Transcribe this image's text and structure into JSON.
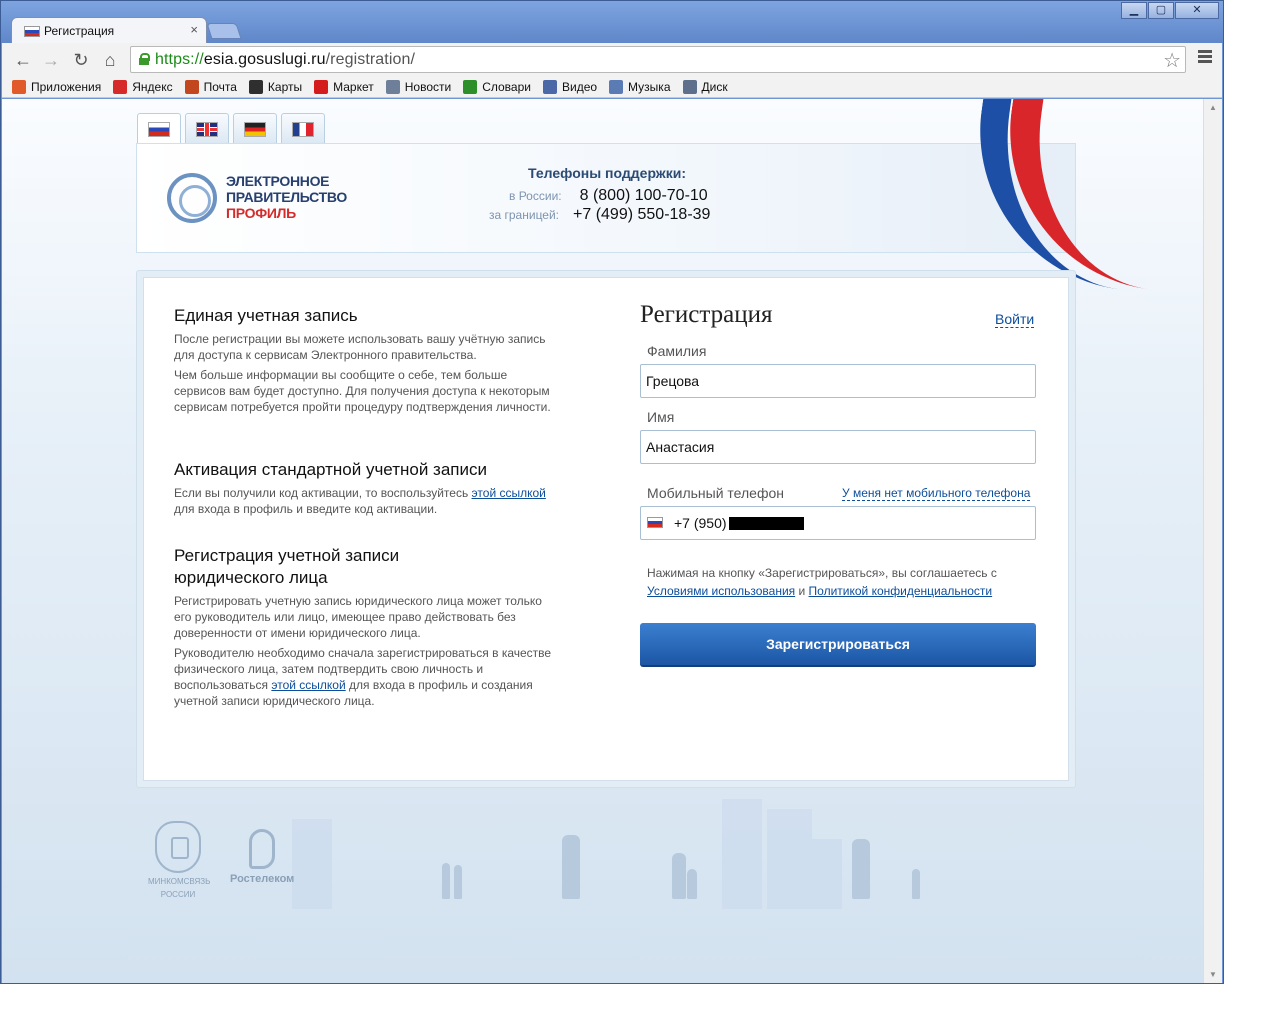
{
  "browser": {
    "tab_title": "Регистрация",
    "tab_close": "×",
    "window_buttons": [
      "▁",
      "▢",
      "✕"
    ],
    "url_scheme": "https://",
    "url_host": "esia.gosuslugi.ru",
    "url_path": "/registration/",
    "nav_icons": [
      "back-icon",
      "forward-icon",
      "reload-icon",
      "home-icon"
    ],
    "bookmarks": [
      {
        "label": "Приложения",
        "icon": "apps-icon",
        "color": "#e05a2a"
      },
      {
        "label": "Яндекс",
        "icon": "yandex-icon",
        "color": "#d62a2a"
      },
      {
        "label": "Почта",
        "icon": "mail-icon",
        "color": "#c2471f"
      },
      {
        "label": "Карты",
        "icon": "maps-icon",
        "color": "#2f2f2f"
      },
      {
        "label": "Маркет",
        "icon": "market-icon",
        "color": "#d41c1c"
      },
      {
        "label": "Новости",
        "icon": "news-icon",
        "color": "#6d7f99"
      },
      {
        "label": "Словари",
        "icon": "dict-icon",
        "color": "#2d8f2a"
      },
      {
        "label": "Видео",
        "icon": "video-icon",
        "color": "#4a69a6"
      },
      {
        "label": "Музыка",
        "icon": "music-icon",
        "color": "#5a7bb4"
      },
      {
        "label": "Диск",
        "icon": "disk-icon",
        "color": "#5d6f8b"
      }
    ]
  },
  "header": {
    "logo_line1": "ЭЛЕКТРОННОЕ",
    "logo_line2": "ПРАВИТЕЛЬСТВО",
    "logo_line3": "ПРОФИЛЬ",
    "support_title": "Телефоны поддержки:",
    "phone_russia_label": "в России:",
    "phone_russia": "8 (800) 100-70-10",
    "phone_abroad_label": "за границей:",
    "phone_abroad": "+7 (499) 550-18-39",
    "languages": [
      "ru",
      "en",
      "de",
      "fr"
    ]
  },
  "info": {
    "s1_title": "Единая учетная запись",
    "s1_p1": "После регистрации вы можете использовать вашу учётную запись для доступа к сервисам Электронного правительства.",
    "s1_p2": "Чем больше информации вы сообщите о себе, тем больше сервисов вам будет доступно. Для получения доступа к некоторым сервисам потребуется пройти процедуру подтверждения личности.",
    "s2_title": "Активация стандартной учетной записи",
    "s2_p_pre": "Если вы получили код активации, то воспользуйтесь ",
    "s2_link": "этой ссылкой",
    "s2_p_post": " для входа в профиль и введите код активации.",
    "s3_title_line1": "Регистрация учетной записи",
    "s3_title_line2": "юридического лица",
    "s3_p1": "Регистрировать учетную запись юридического лица может только его руководитель или лицо, имеющее право действовать без доверенности от имени юридического лица.",
    "s3_p2_pre": "Руководителю необходимо сначала зарегистрироваться в качестве физического лица, затем подтвердить свою личность и воспользоваться ",
    "s3_link": "этой ссылкой",
    "s3_p2_post": " для входа в профиль и создания учетной записи юридического лица."
  },
  "form": {
    "title": "Регистрация",
    "login_link": "Войти",
    "lastname_label": "Фамилия",
    "lastname_value": "Грецова",
    "firstname_label": "Имя",
    "firstname_value": "Анастасия",
    "phone_label": "Мобильный телефон",
    "no_phone_link": "У меня нет мобильного телефона",
    "phone_prefix": "+7 (950)",
    "terms_pre": "Нажимая на кнопку «Зарегистрироваться», вы соглашаетесь с ",
    "terms_link1": "Условиями использования",
    "terms_mid": " и ",
    "terms_link2": "Политикой конфиденциальности",
    "submit_label": "Зарегистрироваться"
  },
  "footer": {
    "ministry_line1": "МИНКОМСВЯЗЬ",
    "ministry_line2": "РОССИИ",
    "rostelecom": "Ростелеком"
  },
  "colors": {
    "accent": "#1c56a5",
    "link": "#0d4e9b",
    "logo_red": "#d42b2b",
    "logo_blue": "#27406f"
  }
}
